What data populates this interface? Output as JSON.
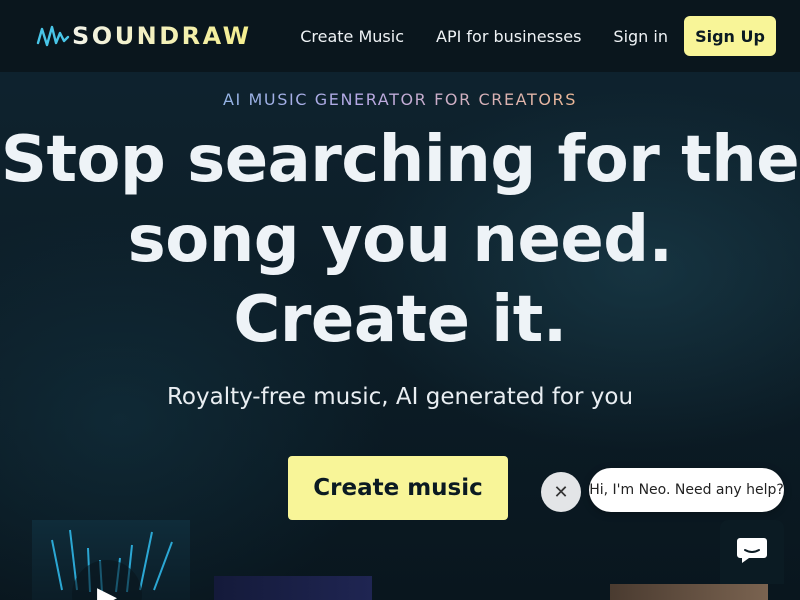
{
  "nav": {
    "logo_text": "SOUNDRAW",
    "links": [
      {
        "label": "Create Music"
      },
      {
        "label": "API for businesses"
      },
      {
        "label": "Sign in"
      }
    ],
    "signup_label": "Sign Up"
  },
  "hero": {
    "eyebrow": "AI MUSIC GENERATOR FOR CREATORS",
    "headline_lines": [
      "Stop searching for the",
      "song you need.",
      "Create it."
    ],
    "subhead": "Royalty-free music, AI generated for you",
    "cta_label": "Create music"
  },
  "chat": {
    "message": "Hi, I'm Neo. Need any help?",
    "close_glyph": "✕"
  },
  "thumbnails": {
    "play_glyph": "▶"
  },
  "colors": {
    "accent": "#f8f598",
    "background": "#0d1a22",
    "nav_background": "#0a161d"
  },
  "icons": [
    "soundraw-logo-icon",
    "play-icon",
    "close-icon",
    "chat-icon"
  ]
}
